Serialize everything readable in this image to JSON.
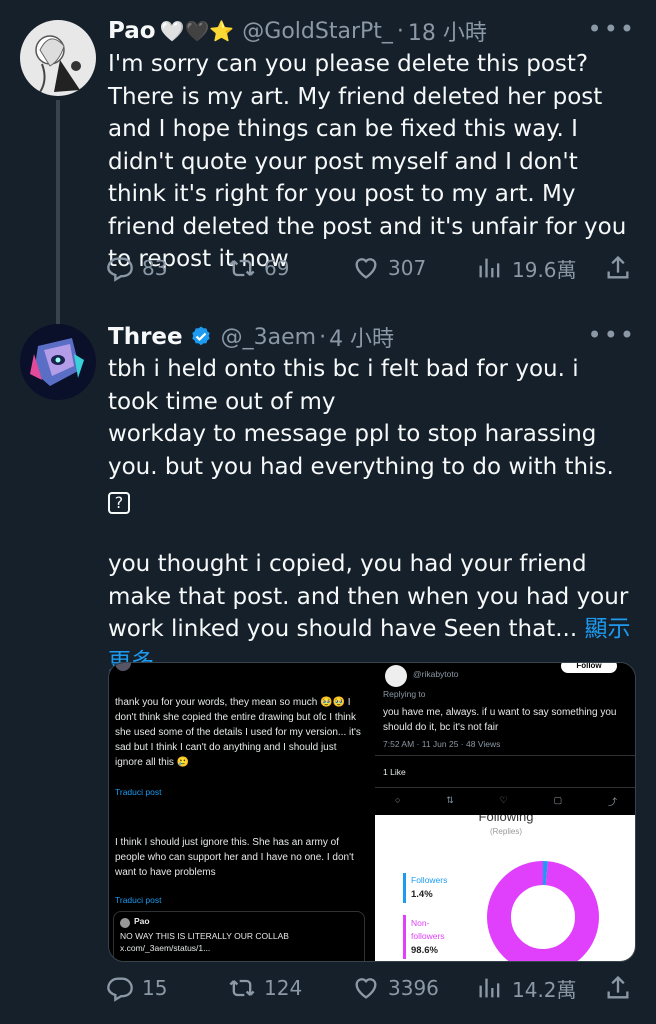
{
  "tweets": [
    {
      "name": "Pao",
      "emojis": "🤍🖤⭐",
      "handle": "@GoldStarPt_",
      "time": "18 小時",
      "text": "I'm sorry can you please delete this post? There is my art. My friend deleted her post and I hope things can be fixed this way. I didn't quote your post myself and I don't think it's right for you post to my art. My friend deleted the post and it's unfair for you to repost it now",
      "replies": "83",
      "reposts": "69",
      "likes": "307",
      "views": "19.6萬"
    },
    {
      "name": "Three",
      "handle": "@_3aem",
      "time": "4 小時",
      "text_lines": [
        "tbh i held onto this bc i felt bad for you. i took time out of my",
        "workday to message ppl to stop harassing you. but you had everything to do with this."
      ],
      "text_para2": "you thought i copied, you had your friend make that post. and then when you had your work linked you should have Seen that...",
      "show_more": "顯示更多",
      "replies": "15",
      "reposts": "124",
      "likes": "3396",
      "views": "14.2萬"
    }
  ],
  "media": {
    "c1": {
      "text": "thank you for your words, they mean so much 🥹🥹 I don't think she copied the entire drawing but ofc I think she used some of the details I used for my version... it's sad but I think I can't do anything and I should just ignore all this 🥲",
      "translate": "Traduci post"
    },
    "c2": {
      "handle": "@rikabytoto",
      "follow": "Follow",
      "replying": "Replying to",
      "text": "you have me, always. if u want to say something you should do it, bc it's not fair",
      "meta": "7:52 AM · 11 Jun 25 · 48 Views",
      "likes": "1 Like"
    },
    "c3": {
      "text": "I think I should just ignore this. She has an army of people who can support her and I have no one. I don't want to have problems",
      "translate": "Traduci post",
      "quote_name": "Pao",
      "quote_text": "NO WAY THIS IS LITERALLY OUR COLLAB x.com/_3aem/status/1..."
    },
    "c4": {
      "title": "Following",
      "subtitle": "(Replies)",
      "followers_label": "Followers",
      "followers_value": "1.4%",
      "nonfollowers_label": "Non-followers",
      "nonfollowers_value": "98.6%",
      "followers_pct": 1.4,
      "nonfollowers_pct": 98.6,
      "followers_color": "#1d9bf0",
      "nonfollowers_color": "#e040fb"
    }
  },
  "colors": {
    "background": "#15202b",
    "text": "#f7f9f9",
    "secondary": "#8b98a5",
    "accent": "#1d9bf0",
    "verified": "#1d9bf0"
  }
}
